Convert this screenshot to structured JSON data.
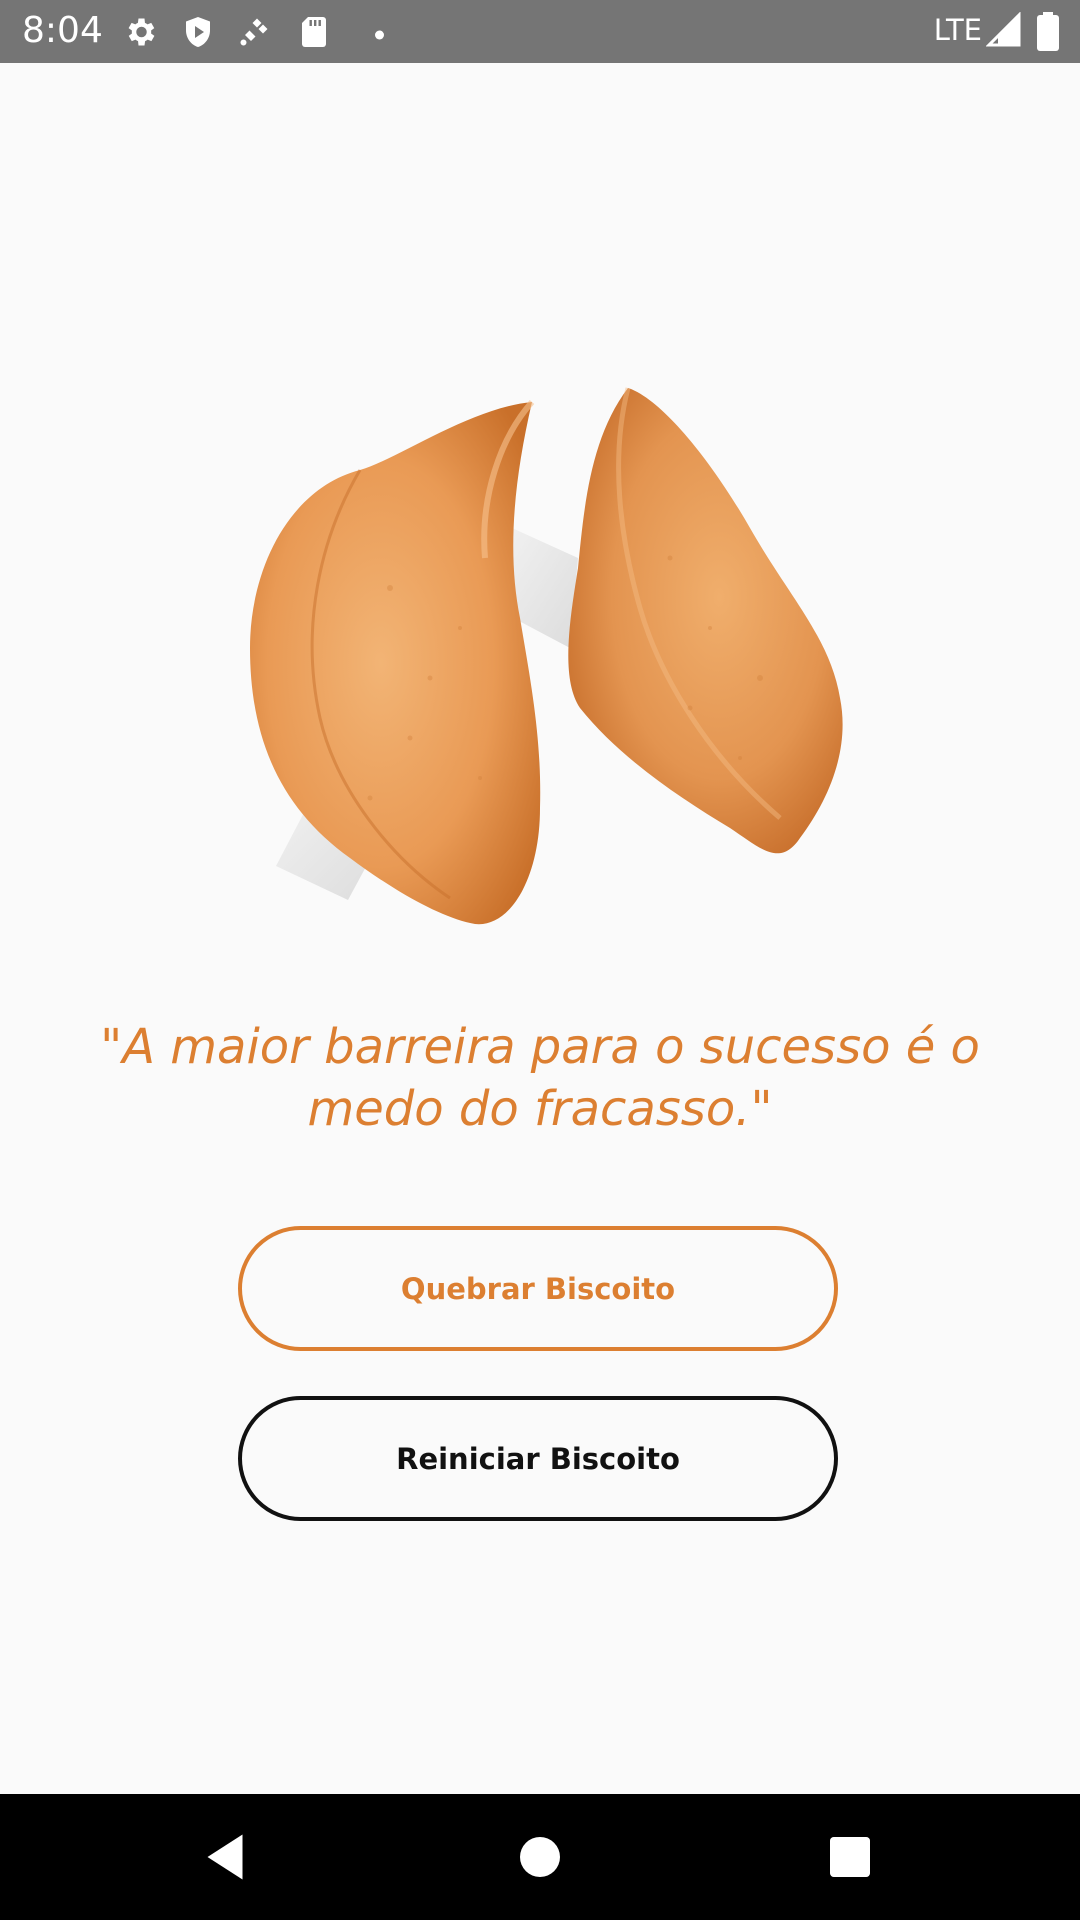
{
  "status_bar": {
    "time": "8:04",
    "network": "LTE",
    "icons_left": [
      "gear-icon",
      "shield-icon",
      "satellite-icon",
      "sd-card-icon",
      "dot-icon"
    ],
    "icons_right": [
      "signal-icon",
      "battery-icon"
    ]
  },
  "cookie_image": {
    "icon": "fortune-cookie-illustration"
  },
  "quote": {
    "text": "\"A maior barreira para o sucesso é o medo do fracasso.\""
  },
  "buttons": {
    "break_label": "Quebrar Biscoito",
    "reset_label": "Reiniciar Biscoito"
  },
  "nav_bar": {
    "icons": [
      "back-icon",
      "home-icon",
      "recents-icon"
    ]
  },
  "colors": {
    "accent": "#dc7f31",
    "background": "#fafafa",
    "status_bar": "#757575",
    "nav_bar": "#000000"
  }
}
